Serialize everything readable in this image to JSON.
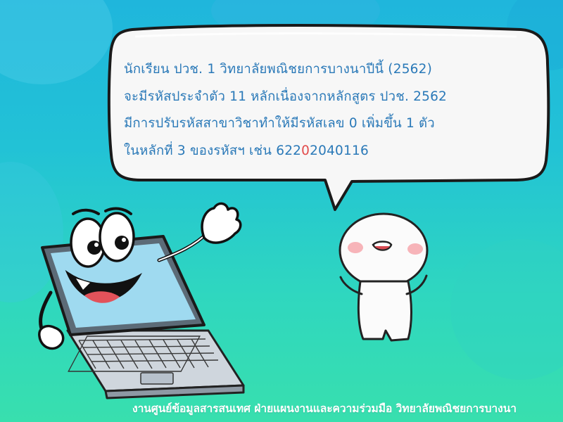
{
  "bubble": {
    "line1": "นักเรียน ปวช. 1 วิทยาลัยพณิชยการบางนาปีนี้ (2562)",
    "line2": "จะมีรหัสประจำตัว 11 หลักเนื่องจากหลักสูตร ปวช. 2562",
    "line3": "มีการปรับรหัสสาขาวิชาทำให้มีรหัสเลข 0 เพิ่มขึ้น 1 ตัว",
    "line4_prefix": "ในหลักที่ 3 ของรหัสฯ เช่น 622",
    "line4_highlight": "0",
    "line4_suffix": "2040116"
  },
  "footer": {
    "credit": "งานศูนย์ข้อมูลสารสนเทศ ฝ่ายแผนงานและความร่วมมือ วิทยาลัยพณิชยการบางนา"
  },
  "colors": {
    "bubble_text": "#2a79b8",
    "highlight_digit": "#e24a4a",
    "background_top": "#1fb6dc",
    "background_bottom": "#38dfae"
  },
  "illustrations": {
    "left": "laptop-mascot-illustration",
    "right": "white-blob-mascot-illustration"
  }
}
